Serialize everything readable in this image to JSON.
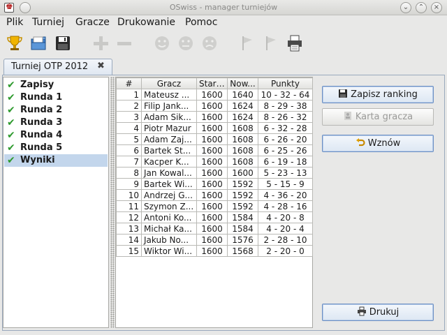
{
  "window": {
    "title": "OSwiss - manager turniejów"
  },
  "menu": [
    "Plik",
    "Turniej",
    "Gracze",
    "Drukowanie",
    "Pomoc"
  ],
  "toolbar": {
    "icons": [
      "trophy-icon",
      "open-folder-icon",
      "save-icon",
      "add-icon",
      "remove-icon",
      "face-icon",
      "face-icon",
      "face-icon",
      "flag-icon",
      "flag-icon",
      "printer-icon"
    ]
  },
  "tab": {
    "label": "Turniej OTP 2012",
    "close": "✖"
  },
  "sidebar": {
    "items": [
      {
        "label": "Zapisy",
        "check": "✔"
      },
      {
        "label": "Runda 1",
        "check": "✔"
      },
      {
        "label": "Runda 2",
        "check": "✔"
      },
      {
        "label": "Runda 3",
        "check": "✔"
      },
      {
        "label": "Runda 4",
        "check": "✔"
      },
      {
        "label": "Runda 5",
        "check": "✔"
      },
      {
        "label": "Wyniki",
        "check": "✔"
      }
    ],
    "selected": 6
  },
  "results": {
    "headers": [
      "#",
      "Gracz",
      "Stary...",
      "Now...",
      "Punkty"
    ],
    "rows": [
      [
        "1",
        "Mateusz ...",
        "1600",
        "1640",
        "10 - 32 - 64"
      ],
      [
        "2",
        "Filip Jank...",
        "1600",
        "1624",
        "8 - 29 - 38"
      ],
      [
        "3",
        "Adam Sik...",
        "1600",
        "1624",
        "8 - 26 - 32"
      ],
      [
        "4",
        "Piotr Mazur",
        "1600",
        "1608",
        "6 - 32 - 28"
      ],
      [
        "5",
        "Adam Zaj...",
        "1600",
        "1608",
        "6 - 26 - 20"
      ],
      [
        "6",
        "Bartek St...",
        "1600",
        "1608",
        "6 - 25 - 26"
      ],
      [
        "7",
        "Kacper K...",
        "1600",
        "1608",
        "6 - 19 - 18"
      ],
      [
        "8",
        "Jan Kowal...",
        "1600",
        "1600",
        "5 - 23 - 13"
      ],
      [
        "9",
        "Bartek Wi...",
        "1600",
        "1592",
        "5 - 15 - 9"
      ],
      [
        "10",
        "Andrzej G...",
        "1600",
        "1592",
        "4 - 36 - 20"
      ],
      [
        "11",
        "Szymon Z...",
        "1600",
        "1592",
        "4 - 28 - 16"
      ],
      [
        "12",
        "Antoni Ko...",
        "1600",
        "1584",
        "4 - 20 - 8"
      ],
      [
        "13",
        "Michał Ka...",
        "1600",
        "1584",
        "4 - 20 - 4"
      ],
      [
        "14",
        "Jakub No...",
        "1600",
        "1576",
        "2 - 28 - 10"
      ],
      [
        "15",
        "Wiktor Wi...",
        "1600",
        "1568",
        "2 - 20 - 0"
      ]
    ]
  },
  "buttons": {
    "save_ranking": "Zapisz ranking",
    "player_card": "Karta gracza",
    "resume": "Wznów",
    "print": "Drukuj"
  }
}
